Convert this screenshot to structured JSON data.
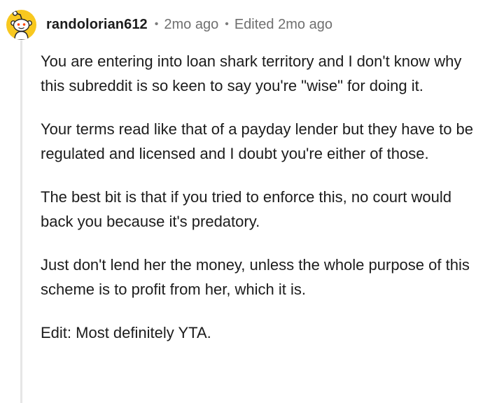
{
  "comment": {
    "avatar_icon": "snoo-avatar-icon",
    "avatar_color": "#f8c81f",
    "username": "randolorian612",
    "separator": "•",
    "time": "2mo ago",
    "edited": "Edited 2mo ago",
    "paragraphs": [
      "You are entering into loan shark territory and I don't know why this subreddit is so keen to say you're \"wise\" for doing it.",
      "Your terms read like that of a payday lender but they have to be regulated and licensed and I doubt you're either of those.",
      "The best bit is that if you tried to enforce this, no court would back you because it's predatory.",
      "Just don't lend her the money, unless the whole purpose of this scheme is to profit from her, which it is.",
      "Edit: Most definitely YTA."
    ]
  }
}
